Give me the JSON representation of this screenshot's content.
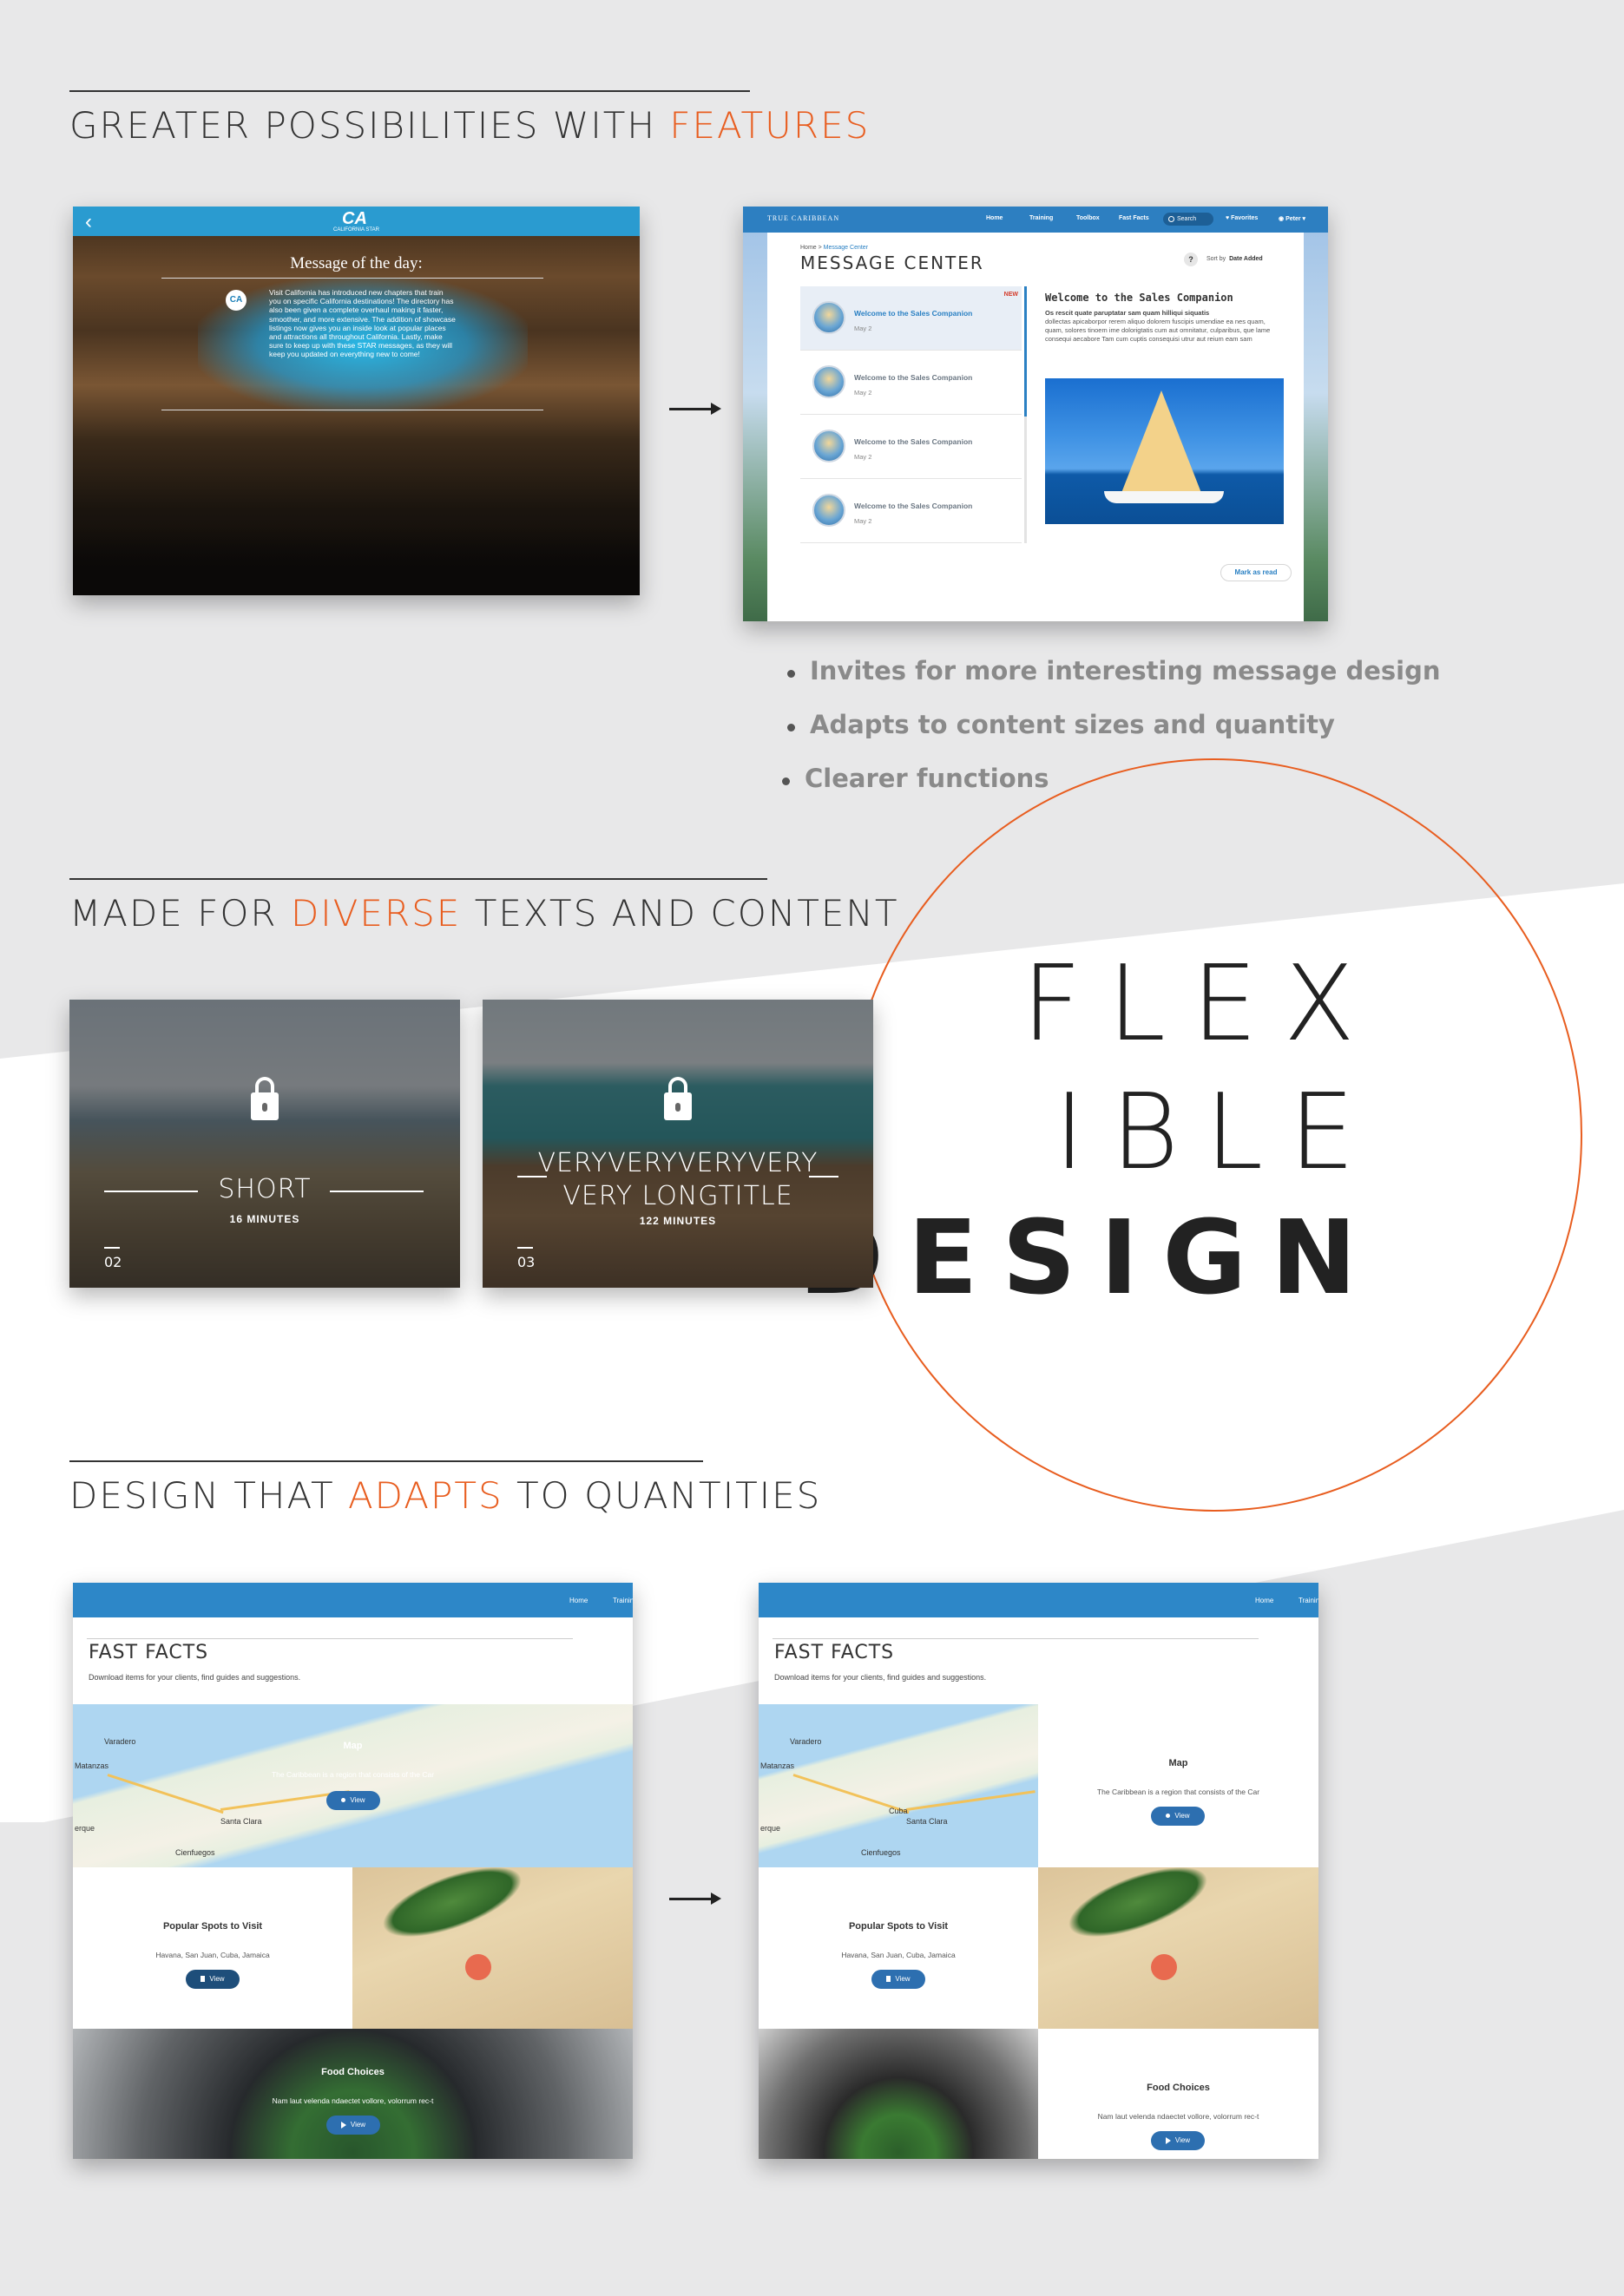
{
  "sections": {
    "features": {
      "prefix": "GREATER POSSIBILITIES WITH ",
      "accent": "FEATURES",
      "suffix": ""
    },
    "diverse": {
      "prefix": "MADE FOR ",
      "accent": "DIVERSE",
      "suffix": " TEXTS AND CONTENT"
    },
    "adapts": {
      "prefix": "DESIGN THAT ",
      "accent": "ADAPTS",
      "suffix": " TO QUANTITIES"
    }
  },
  "old_screen": {
    "logo": "CA",
    "logo_sub": "CALIFORNIA STAR",
    "title": "Message of the day:",
    "avatar": "CA",
    "message": "Visit California has introduced new chapters that train you on specific California destinations! The directory has also been given a complete overhaul making it faster, smoother, and more extensive. The addition of showcase listings now gives you an inside look at popular places and attractions all throughout California. Lastly, make sure to keep up with these STAR messages, as they will keep you updated on everything new to come!"
  },
  "message_center": {
    "brand": "TRUE CARIBBEAN",
    "nav": [
      "Home",
      "Training",
      "Toolbox",
      "Fast Facts"
    ],
    "search": "Search",
    "favorites": "Favorites",
    "user": "Peter",
    "breadcrumb_home": "Home",
    "breadcrumb_sep": " > ",
    "breadcrumb_current": "Message Center",
    "heading": "MESSAGE CENTER",
    "help": "?",
    "sort_label": "Sort by",
    "sort_value": "Date Added",
    "items": [
      {
        "title": "Welcome to the Sales Companion",
        "date": "May 2",
        "badge": "NEW"
      },
      {
        "title": "Welcome to the Sales Companion",
        "date": "May 2",
        "badge": ""
      },
      {
        "title": "Welcome to the Sales Companion",
        "date": "May 2",
        "badge": ""
      },
      {
        "title": "Welcome to the Sales Companion",
        "date": "May 2",
        "badge": ""
      }
    ],
    "detail_title": "Welcome to the Sales Companion",
    "detail_lead": "Os rescit quate paruptatar sam quam hilliqui siquatis",
    "detail_body": "dollectas apicaborpor rerem aliquo dolorem fuscipis umendiae ea nes quam, quam, solores tinoem ime dolorigtatis cum aut omnitatur, culparibus, que lame consequi aecabore Tam cum cuptis consequisi utrur aut reium eam sam",
    "mark_read": "Mark as read"
  },
  "bullets": [
    "Invites for more interesting message design",
    "Adapts to content sizes and quantity",
    "Clearer functions"
  ],
  "flexible": {
    "line1": "FLEX",
    "line2": "IBLE",
    "line3": "DESIGN"
  },
  "cards": [
    {
      "title": "SHORT",
      "minutes": "16 MINUTES",
      "number": "02"
    },
    {
      "title": "VERYVERYVERYVERY VERY LONGTITLE",
      "minutes": "122 MINUTES",
      "number": "03"
    }
  ],
  "fast_facts": {
    "nav_home": "Home",
    "nav_training": "Training",
    "title": "FAST FACTS",
    "subtitle": "Download items for your clients, find guides and suggestions.",
    "map_title": "Map",
    "map_text": "The Caribbean is a region that consists of the Car",
    "map_labels": {
      "a": "Varadero",
      "b": "Matanzas",
      "c": "Santa Clara",
      "d": "Cienfuegos",
      "e": "Cuba",
      "f": "erque"
    },
    "spots_title": "Popular Spots to Visit",
    "spots_text": "Havana, San Juan, Cuba, Jamaica",
    "food_title": "Food Choices",
    "food_text": "Nam laut velenda ndaectet vollore, volorrum rec-t",
    "view": "View"
  }
}
